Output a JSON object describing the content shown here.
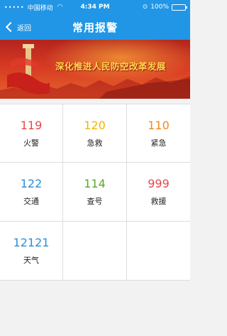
{
  "status_bar": {
    "carrier": "中国移动",
    "time": "4:34 PM",
    "battery": "100%",
    "battery_level": 1.0
  },
  "nav": {
    "back_label": "返回",
    "title": "常用报警"
  },
  "banner": {
    "text": "深化推进人民防空改革发展"
  },
  "hotlines": [
    {
      "number": "119",
      "label": "火警",
      "color": "#e8474b"
    },
    {
      "number": "120",
      "label": "急救",
      "color": "#f5b400"
    },
    {
      "number": "110",
      "label": "紧急",
      "color": "#f08a1c"
    },
    {
      "number": "122",
      "label": "交通",
      "color": "#2a8fd8"
    },
    {
      "number": "114",
      "label": "查号",
      "color": "#5aa82a"
    },
    {
      "number": "999",
      "label": "救援",
      "color": "#e8474b"
    },
    {
      "number": "12121",
      "label": "天气",
      "color": "#2a8fd8"
    }
  ]
}
